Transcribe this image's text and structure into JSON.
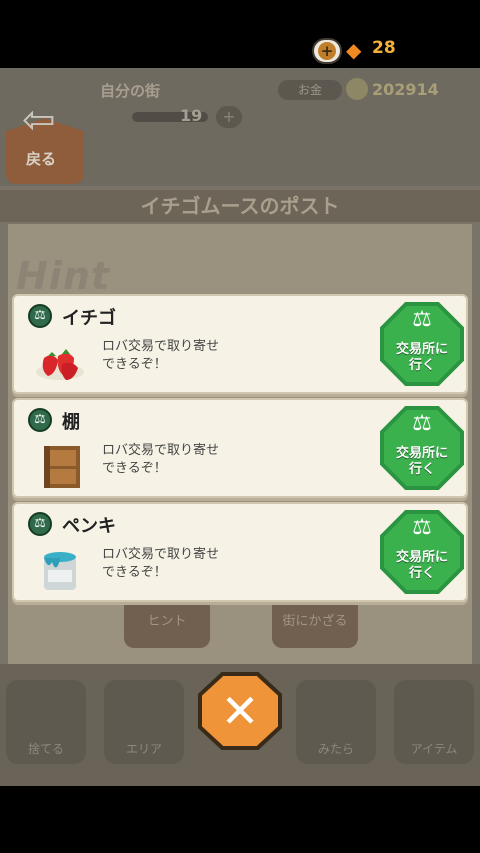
{
  "hud": {
    "back_label": "戻る",
    "town_name": "自分の街",
    "level": "19",
    "money_label": "お金",
    "money_value": "202914",
    "gem_count": "28"
  },
  "post_title": "イチゴムースのポスト",
  "hint_word": "Hint",
  "background_buttons": {
    "hint": "ヒント",
    "decorate": "街にかざる"
  },
  "bottom_nav": [
    "捨てる",
    "エリア",
    "",
    "みたら",
    "アイテム"
  ],
  "hints": [
    {
      "title": "イチゴ",
      "desc_line1": "ロバ交易で取り寄せ",
      "desc_line2": "できるぞ！",
      "button_line1": "交易所に",
      "button_line2": "行く",
      "thumb": "strawberry-icon"
    },
    {
      "title": "棚",
      "desc_line1": "ロバ交易で取り寄せ",
      "desc_line2": "できるぞ！",
      "button_line1": "交易所に",
      "button_line2": "行く",
      "thumb": "shelf-icon"
    },
    {
      "title": "ペンキ",
      "desc_line1": "ロバ交易で取り寄せ",
      "desc_line2": "できるぞ！",
      "button_line1": "交易所に",
      "button_line2": "行く",
      "thumb": "paint-can-icon"
    }
  ],
  "colors": {
    "trade_button": "#3bb14e",
    "close_button": "#ef9438",
    "gem": "#f08a21"
  }
}
